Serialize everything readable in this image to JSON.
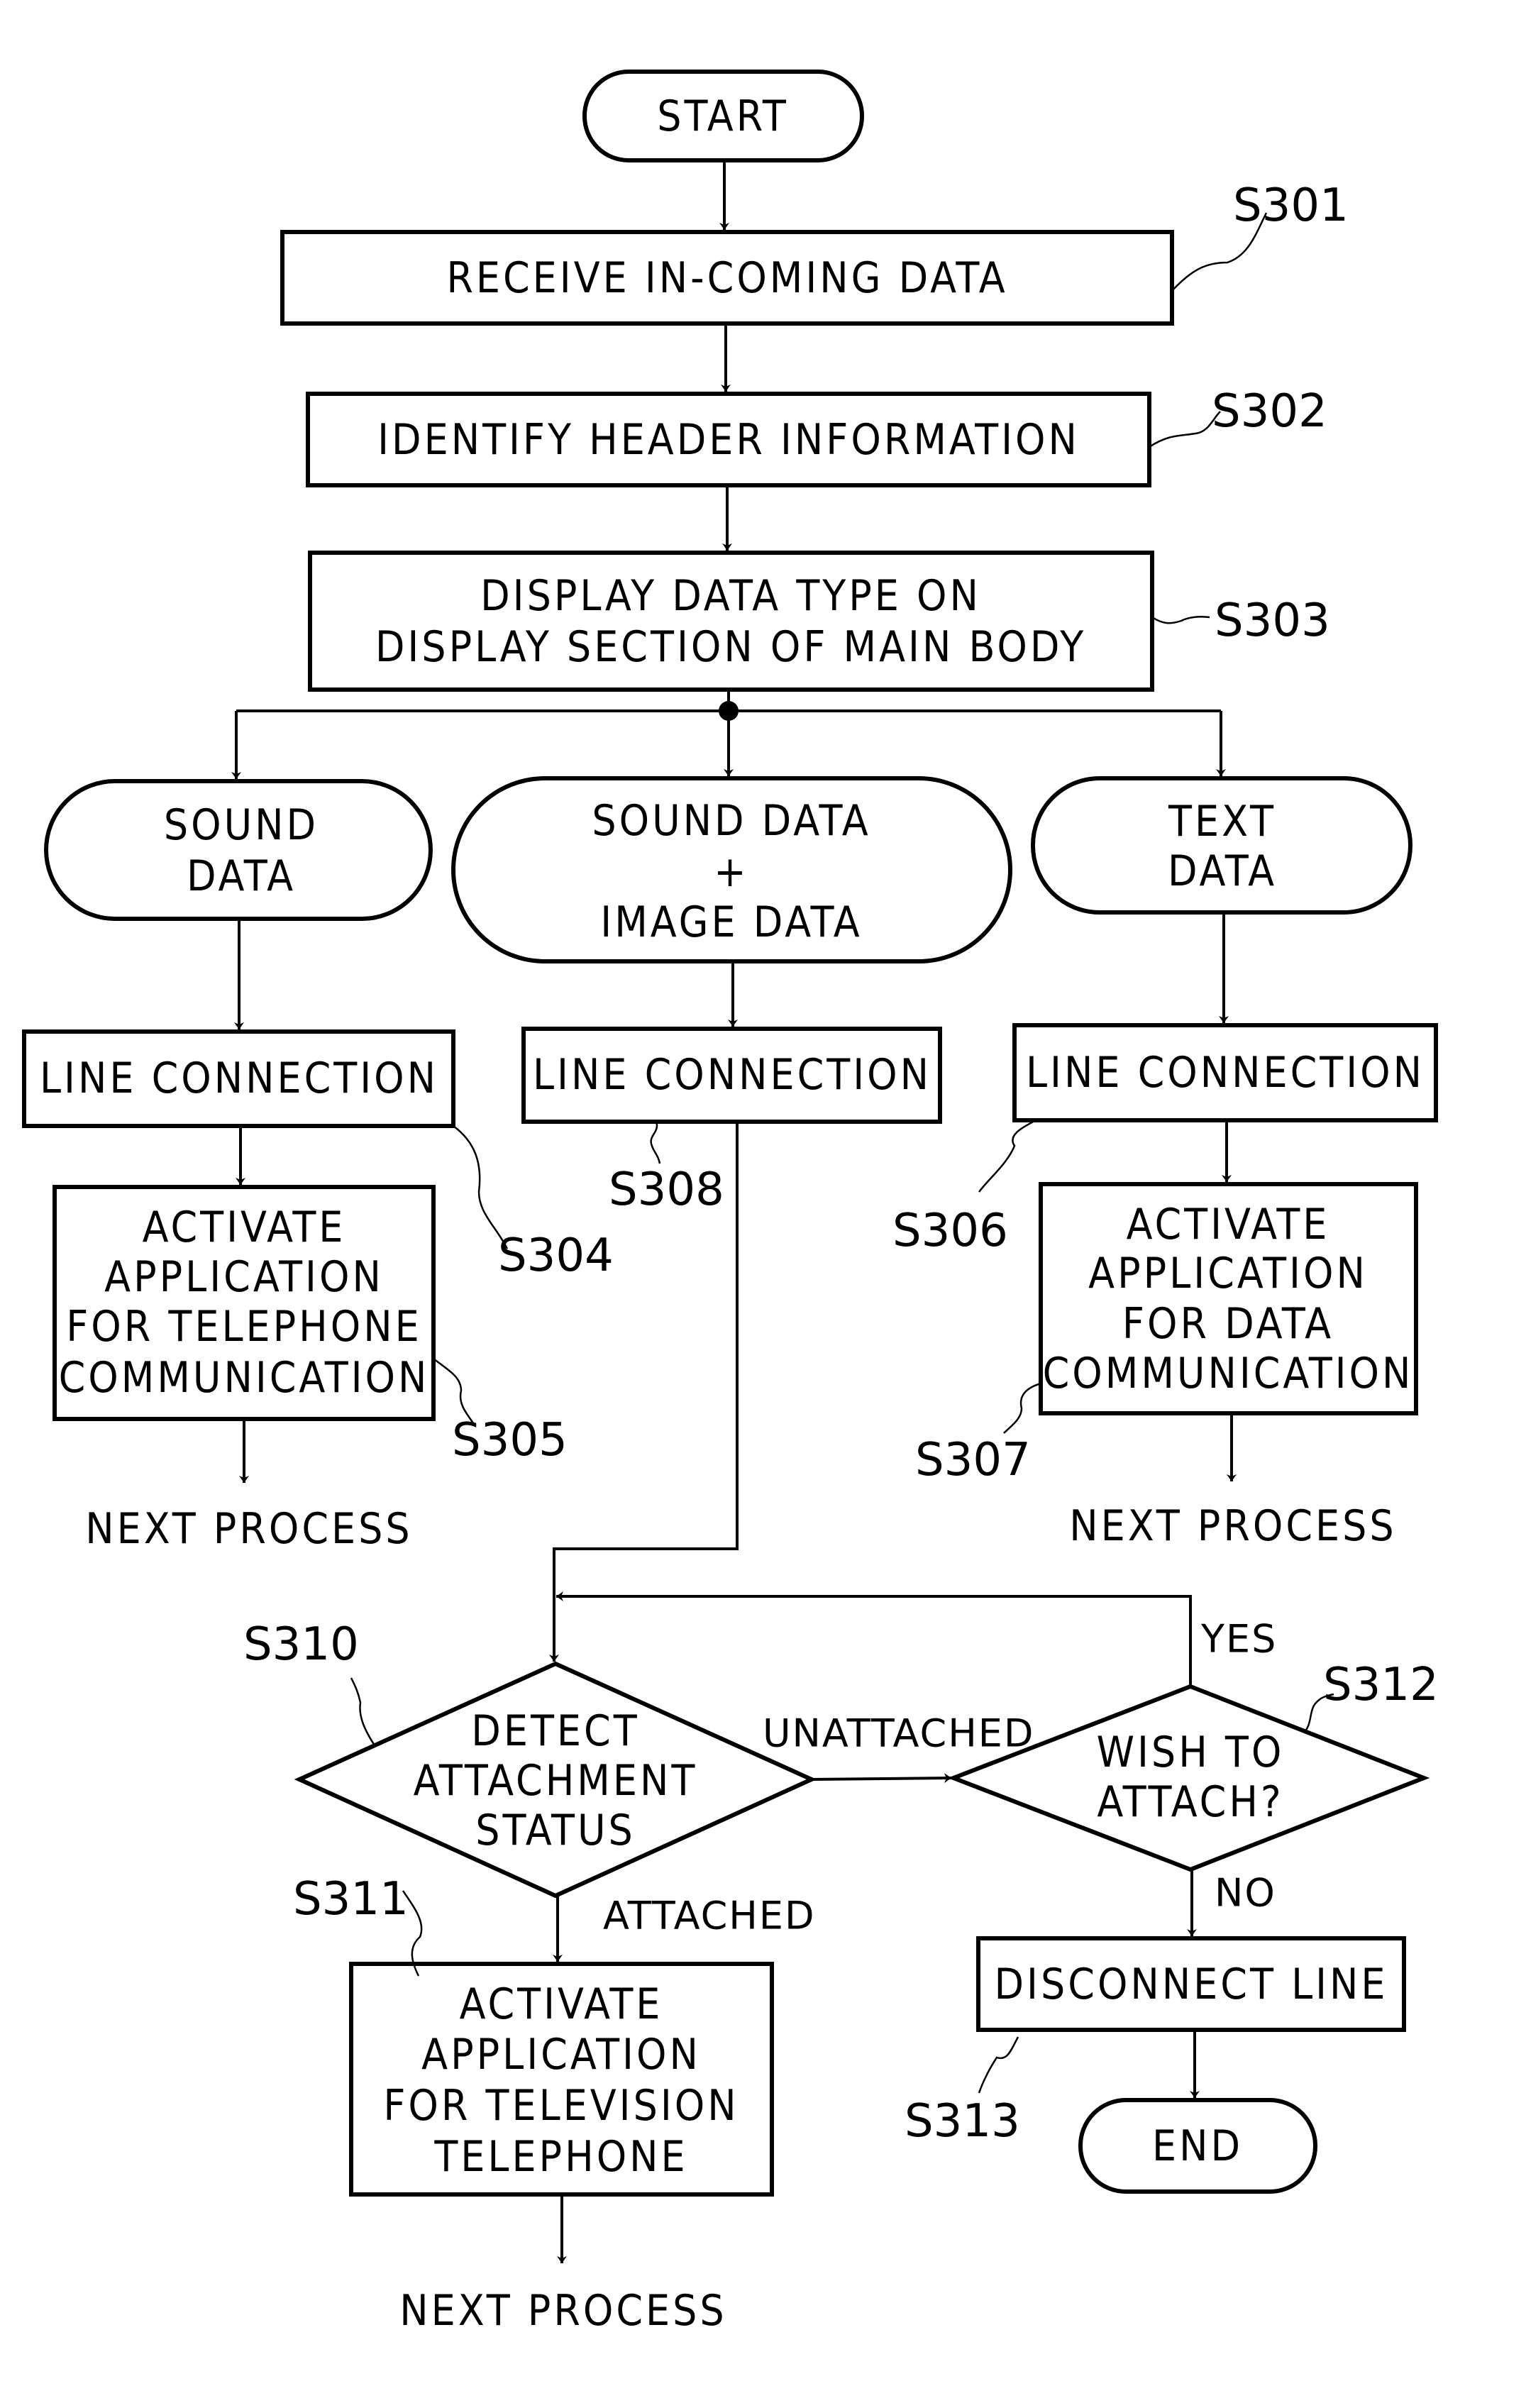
{
  "diagram": {
    "type": "flowchart",
    "nodes": {
      "start": {
        "shape": "terminal",
        "lines": [
          "START"
        ]
      },
      "s301": {
        "shape": "process",
        "step": "S301",
        "lines": [
          "RECEIVE IN-COMING DATA"
        ]
      },
      "s302": {
        "shape": "process",
        "step": "S302",
        "lines": [
          "IDENTIFY HEADER INFORMATION"
        ]
      },
      "s303": {
        "shape": "process",
        "step": "S303",
        "lines": [
          "DISPLAY DATA TYPE ON",
          "DISPLAY SECTION OF MAIN BODY"
        ]
      },
      "sound": {
        "shape": "terminal",
        "lines": [
          "SOUND",
          "DATA"
        ]
      },
      "sound_image": {
        "shape": "terminal",
        "lines": [
          "SOUND DATA",
          "+",
          "IMAGE DATA"
        ]
      },
      "text": {
        "shape": "terminal",
        "lines": [
          "TEXT",
          "DATA"
        ]
      },
      "s304": {
        "shape": "process",
        "step": "S304",
        "lines": [
          "LINE CONNECTION"
        ]
      },
      "s308": {
        "shape": "process",
        "step": "S308",
        "lines": [
          "LINE CONNECTION"
        ]
      },
      "s306": {
        "shape": "process",
        "step": "S306",
        "lines": [
          "LINE CONNECTION"
        ]
      },
      "s305": {
        "shape": "process",
        "step": "S305",
        "lines": [
          "ACTIVATE",
          "APPLICATION",
          "FOR TELEPHONE",
          "COMMUNICATION"
        ]
      },
      "s307": {
        "shape": "process",
        "step": "S307",
        "lines": [
          "ACTIVATE",
          "APPLICATION",
          "FOR DATA",
          "COMMUNICATION"
        ]
      },
      "next_left": {
        "shape": "text",
        "lines": [
          "NEXT PROCESS"
        ]
      },
      "next_right": {
        "shape": "text",
        "lines": [
          "NEXT PROCESS"
        ]
      },
      "s310": {
        "shape": "decision",
        "step": "S310",
        "lines": [
          "DETECT",
          "ATTACHMENT",
          "STATUS"
        ]
      },
      "s312": {
        "shape": "decision",
        "step": "S312",
        "lines": [
          "WISH TO",
          "ATTACH?"
        ]
      },
      "s311": {
        "shape": "process",
        "step": "S311",
        "lines": [
          "ACTIVATE",
          "APPLICATION",
          "FOR TELEVISION",
          "TELEPHONE"
        ]
      },
      "s313": {
        "shape": "process",
        "step": "S313",
        "lines": [
          "DISCONNECT LINE"
        ]
      },
      "end": {
        "shape": "terminal",
        "lines": [
          "END"
        ]
      },
      "next_bottom": {
        "shape": "text",
        "lines": [
          "NEXT PROCESS"
        ]
      }
    },
    "edge_labels": {
      "unattached": "UNATTACHED",
      "attached": "ATTACHED",
      "yes": "YES",
      "no": "NO"
    },
    "edges": [
      [
        "start",
        "s301"
      ],
      [
        "s301",
        "s302"
      ],
      [
        "s302",
        "s303"
      ],
      [
        "s303",
        "sound"
      ],
      [
        "s303",
        "sound_image"
      ],
      [
        "s303",
        "text"
      ],
      [
        "sound",
        "s304"
      ],
      [
        "s304",
        "s305"
      ],
      [
        "s305",
        "next_left"
      ],
      [
        "sound_image",
        "s308"
      ],
      [
        "s308",
        "s310"
      ],
      [
        "text",
        "s306"
      ],
      [
        "s306",
        "s307"
      ],
      [
        "s307",
        "next_right"
      ],
      [
        "s310",
        "s312",
        "UNATTACHED"
      ],
      [
        "s310",
        "s311",
        "ATTACHED"
      ],
      [
        "s312",
        "s310",
        "YES"
      ],
      [
        "s312",
        "s313",
        "NO"
      ],
      [
        "s313",
        "end"
      ],
      [
        "s311",
        "next_bottom"
      ]
    ]
  }
}
